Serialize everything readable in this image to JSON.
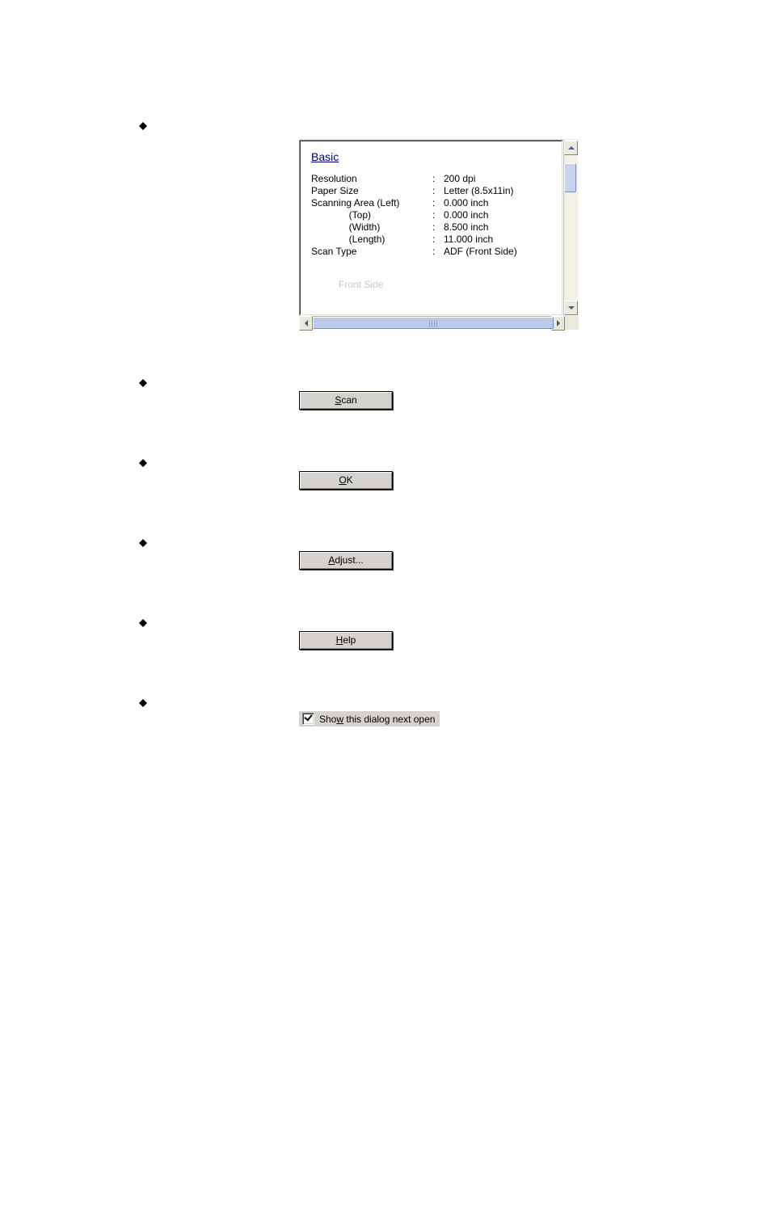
{
  "settings_panel": {
    "heading": "Basic",
    "rows": [
      {
        "key": "Resolution",
        "value": "200 dpi"
      },
      {
        "key": "Paper Size",
        "value": "Letter (8.5x11in)"
      },
      {
        "key": "Scanning Area (Left)",
        "value": "0.000 inch"
      },
      {
        "key": "              (Top)",
        "value": "0.000 inch"
      },
      {
        "key": "              (Width)",
        "value": "8.500 inch"
      },
      {
        "key": "              (Length)",
        "value": "11.000 inch"
      },
      {
        "key": "Scan Type",
        "value": "ADF (Front Side)"
      }
    ],
    "cutoff": "Front Side"
  },
  "buttons": {
    "scan": {
      "mnemonic": "S",
      "rest": "can"
    },
    "ok": {
      "mnemonic": "O",
      "rest": "K"
    },
    "adjust": {
      "mnemonic": "A",
      "rest": "djust..."
    },
    "help": {
      "mnemonic": "H",
      "rest": "elp"
    }
  },
  "checkbox": {
    "pre": "Sho",
    "mnemonic": "w",
    "post": " this dialog next open"
  }
}
